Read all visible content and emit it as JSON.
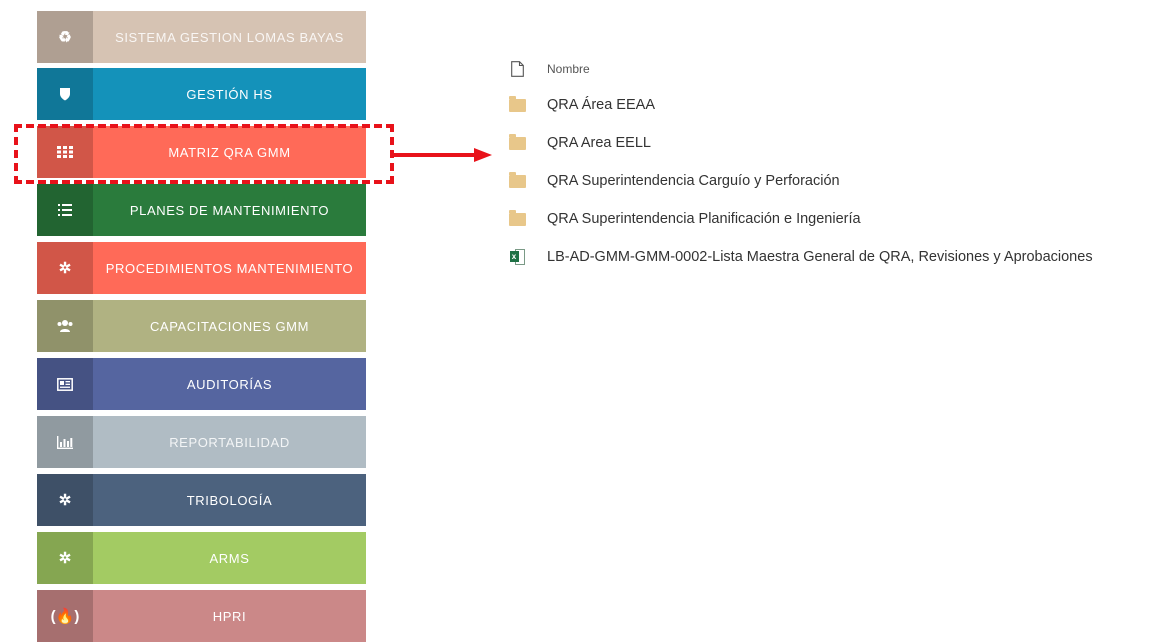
{
  "nav": {
    "tiles": [
      {
        "label": "SISTEMA GESTION LOMAS BAYAS",
        "icon": "recycle-icon",
        "color": "#d6c3b3"
      },
      {
        "label": "GESTIÓN HS",
        "icon": "shield-icon",
        "color": "#1492ba"
      },
      {
        "label": "MATRIZ QRA GMM",
        "icon": "grid-icon",
        "color": "#ff6a58"
      },
      {
        "label": "PLANES DE MANTENIMIENTO",
        "icon": "list-icon",
        "color": "#2a7b3c"
      },
      {
        "label": "PROCEDIMIENTOS MANTENIMIENTO",
        "icon": "gears-icon",
        "color": "#ff6a58"
      },
      {
        "label": "CAPACITACIONES GMM",
        "icon": "users-icon",
        "color": "#b0b282"
      },
      {
        "label": "AUDITORÍAS",
        "icon": "newspaper-icon",
        "color": "#5565a0"
      },
      {
        "label": "REPORTABILIDAD",
        "icon": "bar-chart-icon",
        "color": "#b0bcc4"
      },
      {
        "label": "TRIBOLOGÍA",
        "icon": "gears-icon",
        "color": "#4c627e"
      },
      {
        "label": "ARMS",
        "icon": "gears-icon",
        "color": "#a3cb63"
      },
      {
        "label": "HPRI",
        "icon": "fire-icon",
        "color": "#cb8888"
      }
    ]
  },
  "files": {
    "header": "Nombre",
    "items": [
      {
        "name": "QRA Área EEAA",
        "type": "folder"
      },
      {
        "name": "QRA Area EELL",
        "type": "folder"
      },
      {
        "name": "QRA Superintendencia Carguío y Perforación",
        "type": "folder"
      },
      {
        "name": "QRA Superintendencia Planificación e Ingeniería",
        "type": "folder"
      },
      {
        "name": "LB-AD-GMM-GMM-0002-Lista Maestra General de QRA, Revisiones y Aprobaciones",
        "type": "excel"
      }
    ]
  },
  "annotation": {
    "color": "#e8121a"
  }
}
